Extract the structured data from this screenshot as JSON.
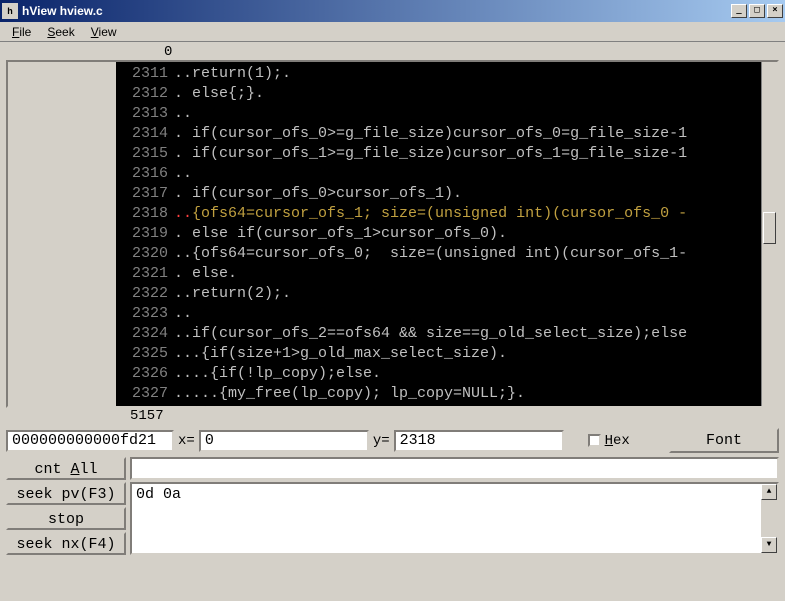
{
  "window": {
    "title": "hView hview.c",
    "icon_glyph": "h"
  },
  "menu": {
    "file": "File",
    "seek": "Seek",
    "view": "View"
  },
  "ruler_top": "0",
  "ruler_bottom": "5157",
  "gutter_lines": [
    "2311",
    "2312",
    "2313",
    "2314",
    "2315",
    "2316",
    "2317",
    "2318",
    "2319",
    "2320",
    "2321",
    "2322",
    "2323",
    "2324",
    "2325",
    "2326",
    "2327"
  ],
  "code_lines": [
    {
      "t": "..return(1);."
    },
    {
      "t": ". else{;}."
    },
    {
      "t": ".."
    },
    {
      "t": ". if(cursor_ofs_0>=g_file_size)cursor_ofs_0=g_file_size-1"
    },
    {
      "t": ". if(cursor_ofs_1>=g_file_size)cursor_ofs_1=g_file_size-1"
    },
    {
      "t": ".."
    },
    {
      "t": ". if(cursor_ofs_0>cursor_ofs_1)."
    },
    {
      "pre": "",
      "red": "..",
      "hl": "{ofs64=cursor_ofs_1; size=(unsigned int)(cursor_ofs_0 -",
      "post": ""
    },
    {
      "t": ". else if(cursor_ofs_1>cursor_ofs_0)."
    },
    {
      "t": "..{ofs64=cursor_ofs_0;  size=(unsigned int)(cursor_ofs_1-"
    },
    {
      "t": ". else."
    },
    {
      "t": "..return(2);."
    },
    {
      "t": ".."
    },
    {
      "t": "..if(cursor_ofs_2==ofs64 && size==g_old_select_size);else"
    },
    {
      "t": "...{if(size+1>g_old_max_select_size)."
    },
    {
      "t": "....{if(!lp_copy);else."
    },
    {
      "t": ".....{my_free(lp_copy); lp_copy=NULL;}."
    }
  ],
  "controls": {
    "addr_value": "000000000000fd21",
    "x_label": "x=",
    "x_value": "0",
    "y_label": "y=",
    "y_value": "2318",
    "hex_label": "Hex",
    "font_btn": "Font",
    "cnt_all_btn": "cnt All",
    "seek_pv_btn": "seek pv(F3)",
    "stop_btn": "stop",
    "seek_nx_btn": "seek nx(F4)",
    "search_value": "0d 0a"
  }
}
